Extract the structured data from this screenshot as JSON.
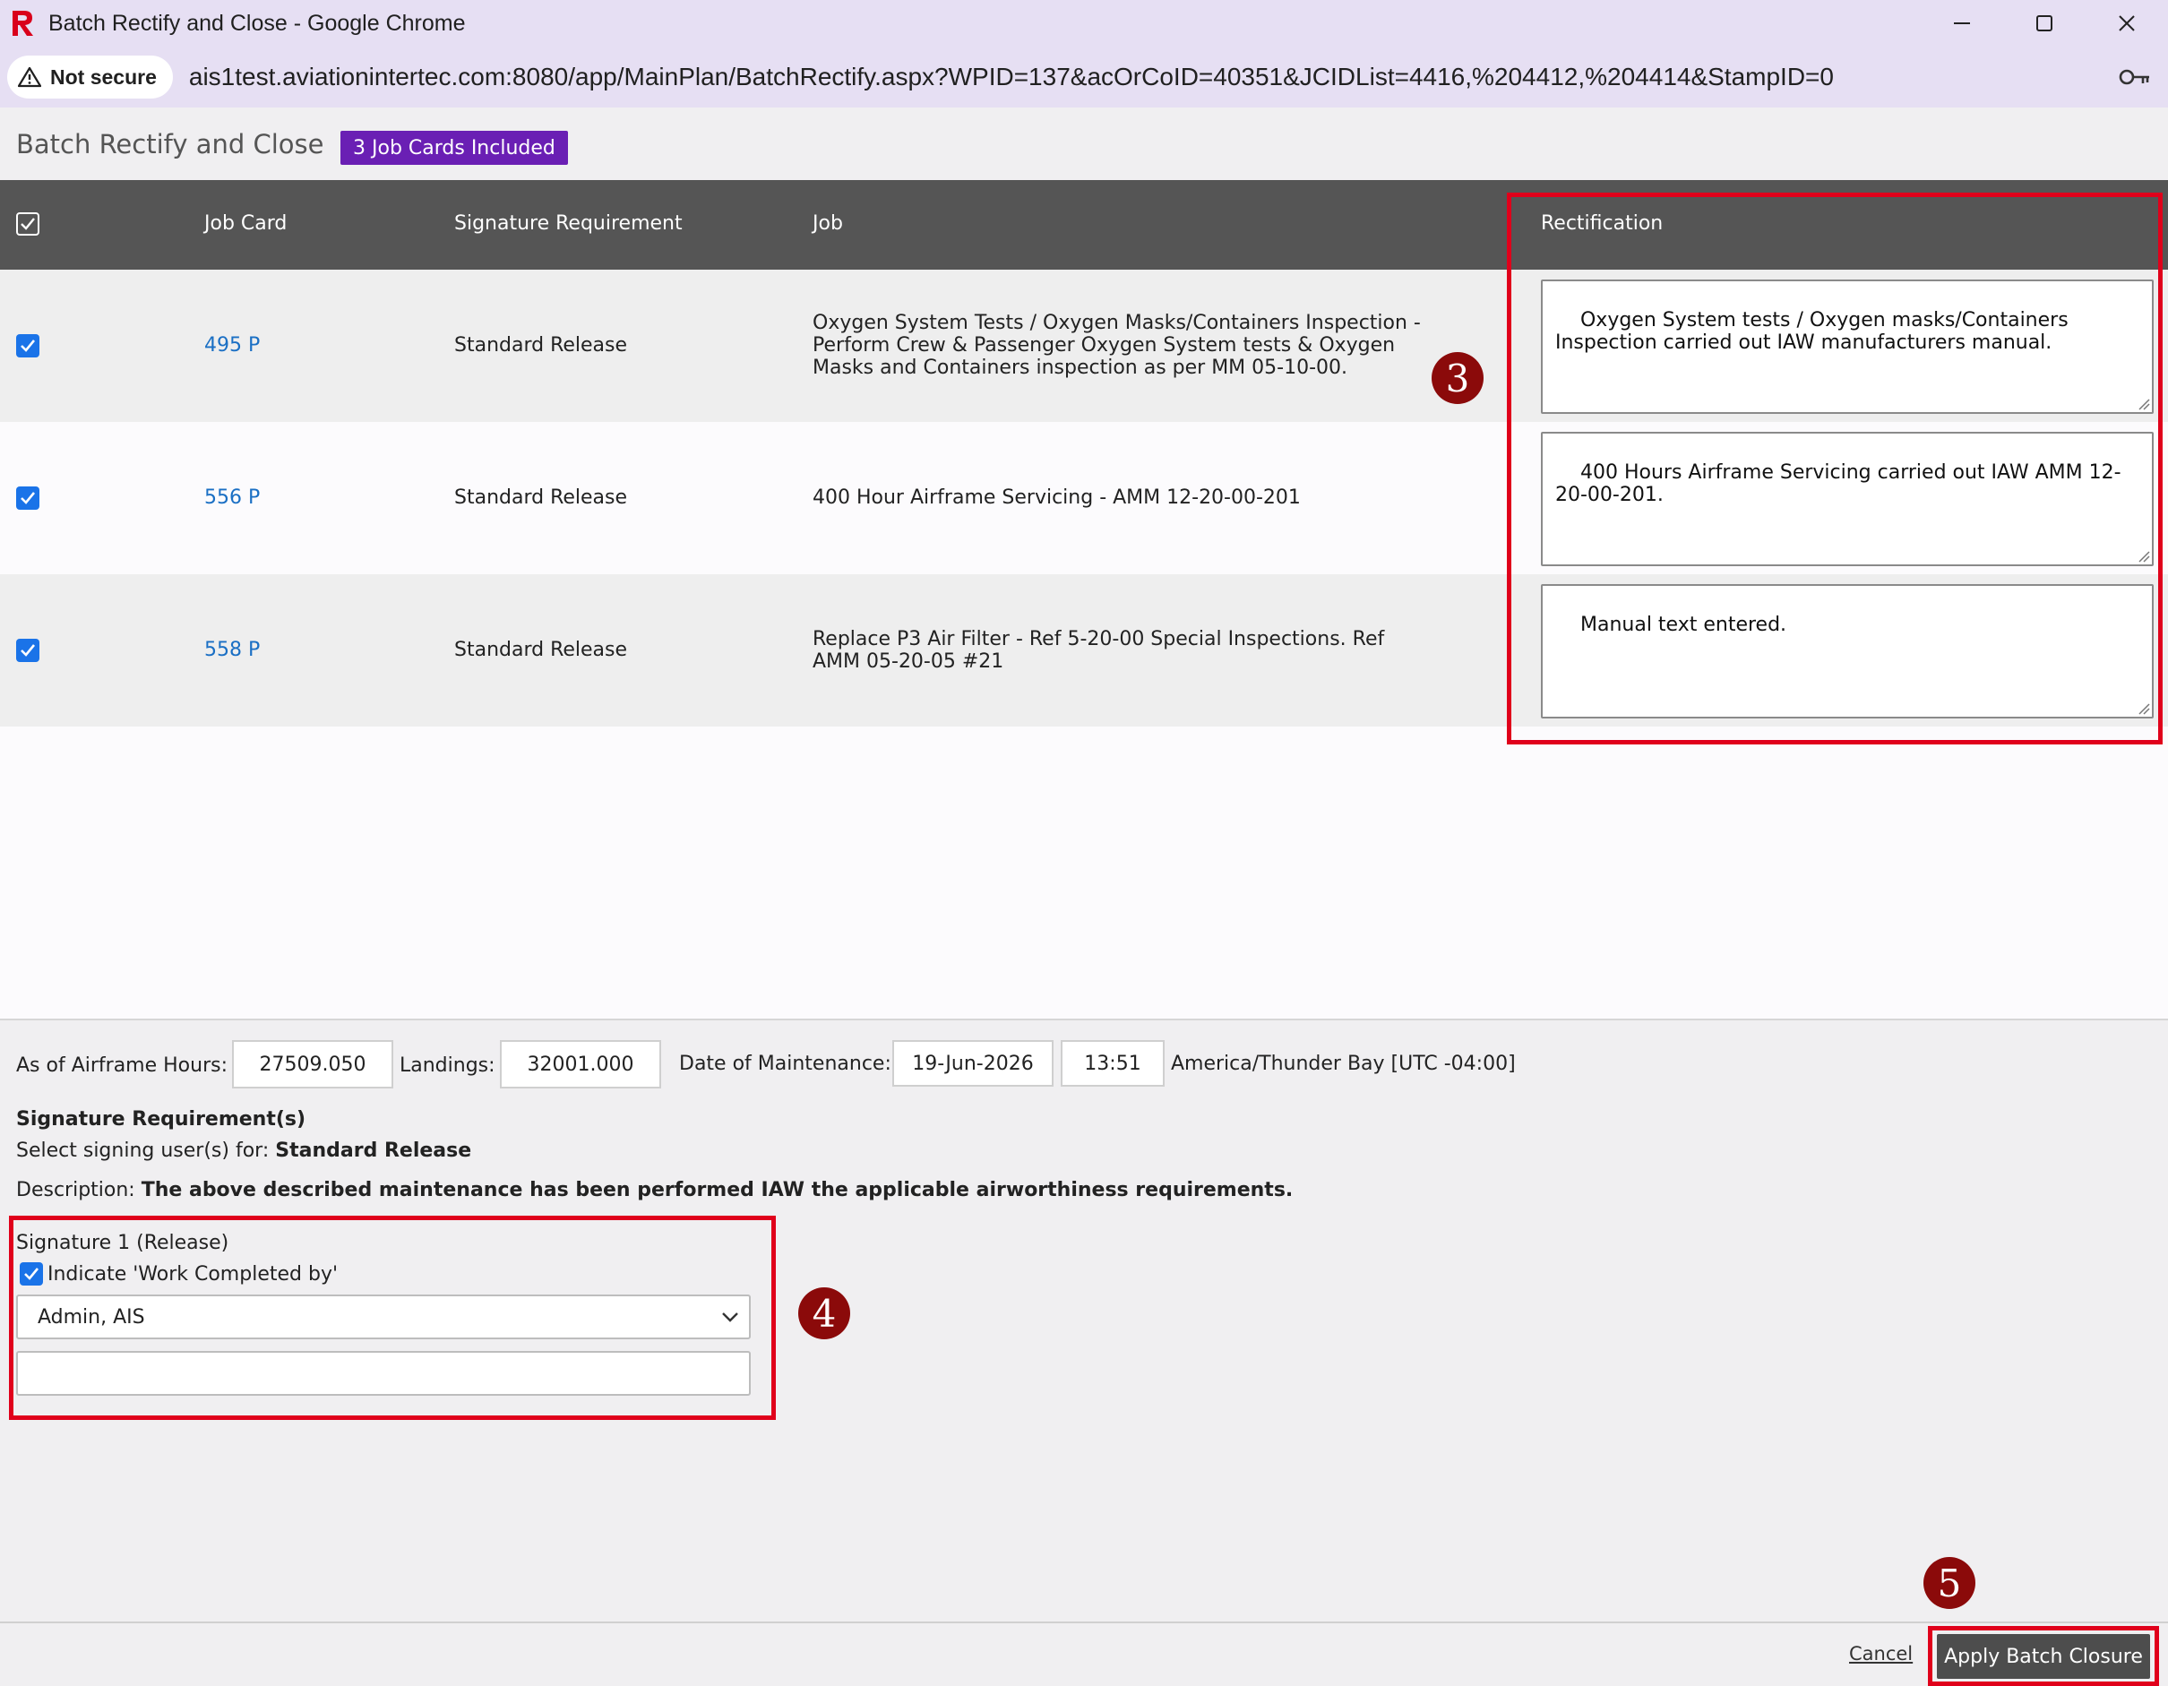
{
  "window": {
    "title": "Batch Rectify and Close - Google Chrome",
    "security_label": "Not secure",
    "url": "ais1test.aviationintertec.com:8080/app/MainPlan/BatchRectify.aspx?WPID=137&acOrCoID=40351&JCIDList=4416,%204412,%204414&StampID=0"
  },
  "header": {
    "title": "Batch Rectify and Close",
    "badge": "3 Job Cards Included"
  },
  "table": {
    "columns": {
      "job_card": "Job Card",
      "signature_requirement": "Signature Requirement",
      "job": "Job",
      "rectification": "Rectification"
    },
    "rows": [
      {
        "job_card": "495 P",
        "signature_requirement": "Standard Release",
        "job": "Oxygen System Tests / Oxygen Masks/Containers Inspection - Perform Crew & Passenger Oxygen System tests & Oxygen Masks and Containers inspection as per MM 05-10-00.",
        "rectification": "Oxygen System tests / Oxygen masks/Containers Inspection carried out IAW manufacturers manual."
      },
      {
        "job_card": "556 P",
        "signature_requirement": "Standard Release",
        "job": "400 Hour Airframe Servicing - AMM 12-20-00-201",
        "rectification": "400 Hours Airframe Servicing carried out IAW AMM 12-20-00-201."
      },
      {
        "job_card": "558 P",
        "signature_requirement": "Standard Release",
        "job": "Replace P3 Air Filter - Ref 5-20-00 Special Inspections. Ref AMM 05-20-05 #21",
        "rectification": "Manual text entered."
      }
    ]
  },
  "form": {
    "airframe_hours_label": "As of Airframe Hours:",
    "airframe_hours": "27509.050",
    "landings_label": "Landings:",
    "landings": "32001.000",
    "date_label": "Date of Maintenance:",
    "date": "19-Jun-2026",
    "time": "13:51",
    "timezone": "America/Thunder Bay [UTC -04:00]",
    "sig_req_heading": "Signature Requirement(s)",
    "select_users_label": "Select signing user(s) for:",
    "select_users_value": "Standard Release",
    "description_label": "Description:",
    "description_value": "The above described maintenance has been performed IAW the applicable airworthiness requirements.",
    "signature_title": "Signature 1 (Release)",
    "indicate_label": "Indicate 'Work Completed by'",
    "signer": "Admin, AIS"
  },
  "footer": {
    "cancel": "Cancel",
    "apply": "Apply Batch Closure"
  },
  "annotations": {
    "step3": "3",
    "step4": "4",
    "step5": "5"
  },
  "colors": {
    "badge": "#6a1fb4",
    "highlight": "#e0001b",
    "step_marker": "#8b0a0a",
    "table_header": "#555555",
    "link": "#1a6fc4"
  }
}
